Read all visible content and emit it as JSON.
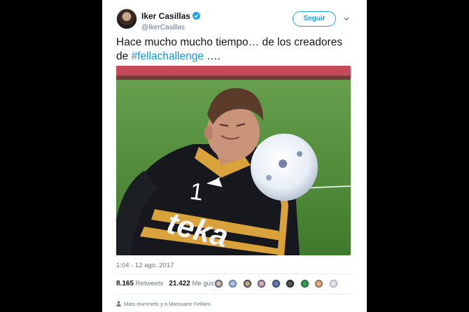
{
  "tweet": {
    "author_name": "Iker Casillas",
    "author_handle": "@IkerCasillas",
    "follow_label": "Seguir",
    "text_before": "Hace mucho mucho tiempo… de los creadores de ",
    "hashtag": "#fellachallenge",
    "text_after": " ….",
    "timestamp": "1:04 - 12 ago. 2017",
    "retweets_count": "8.165",
    "retweets_label": "Retweets",
    "likes_count": "21.422",
    "likes_label": "Me gusta",
    "footer_text": "Mats Hummels y a Marouane Fellaini"
  },
  "media": {
    "jersey_number": "1",
    "sponsor": "teka"
  },
  "colors": {
    "accent": "#1da1f2",
    "hashtag": "#1b95e0",
    "muted": "#657786"
  },
  "icons": [
    "verified-badge-icon",
    "chevron-down-icon",
    "person-icon"
  ]
}
